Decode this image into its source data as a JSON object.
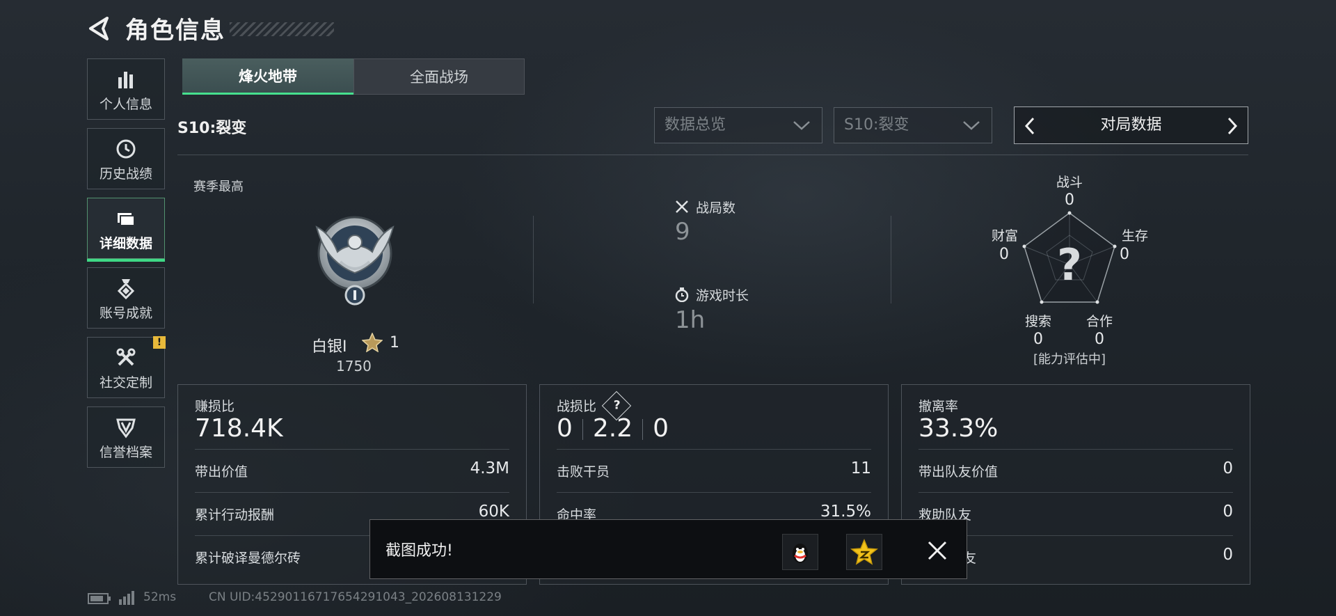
{
  "header": {
    "title": "角色信息"
  },
  "sidebar": {
    "items": [
      {
        "label": "个人信息",
        "icon": "bar-chart-icon"
      },
      {
        "label": "历史战绩",
        "icon": "clock-history-icon"
      },
      {
        "label": "详细数据",
        "icon": "folder-icon",
        "active": true
      },
      {
        "label": "账号成就",
        "icon": "medal-icon"
      },
      {
        "label": "社交定制",
        "icon": "tools-icon",
        "badge": "!"
      },
      {
        "label": "信誉档案",
        "icon": "shield-emblem-icon"
      }
    ]
  },
  "tabs": [
    {
      "label": "烽火地带",
      "active": true
    },
    {
      "label": "全面战场"
    }
  ],
  "season": {
    "label": "S10:裂变"
  },
  "filters": {
    "overview": "数据总览",
    "season": "S10:裂变",
    "pager": "对局数据"
  },
  "rank": {
    "heading": "赛季最高",
    "name": "白银I",
    "stars": "1",
    "score": "1750"
  },
  "stats": {
    "matches_label": "战局数",
    "matches_value": "9",
    "playtime_label": "游戏时长",
    "playtime_value": "1h"
  },
  "radar": {
    "combat": {
      "label": "战斗",
      "value": "0"
    },
    "survival": {
      "label": "生存",
      "value": "0"
    },
    "cooperation": {
      "label": "合作",
      "value": "0"
    },
    "search": {
      "label": "搜索",
      "value": "0"
    },
    "wealth": {
      "label": "财富",
      "value": "0"
    },
    "status": "[能力评估中]",
    "center": "?"
  },
  "cards": {
    "profit": {
      "title": "赚损比",
      "value": "718.4K",
      "rows": [
        {
          "label": "带出价值",
          "value": "4.3M"
        },
        {
          "label": "累计行动报酬",
          "value": "60K"
        },
        {
          "label": "累计破译曼德尔砖",
          "value": ""
        }
      ]
    },
    "combat": {
      "title": "战损比",
      "help": "?",
      "kd": [
        "0",
        "2.2",
        "0"
      ],
      "rows": [
        {
          "label": "击败干员",
          "value": "11"
        },
        {
          "label": "命中率",
          "value": "31.5%"
        }
      ]
    },
    "extract": {
      "title": "撤离率",
      "value": "33.3%",
      "rows": [
        {
          "label": "带出队友价值",
          "value": "0"
        },
        {
          "label": "救助队友",
          "value": "0"
        },
        {
          "label": "友",
          "value": "0"
        }
      ]
    }
  },
  "toast": {
    "text": "截图成功!"
  },
  "footer": {
    "ping": "52ms",
    "uid": "CN UID:452901167176542910​43_202608131229"
  },
  "colors": {
    "accent": "#3fd986",
    "warning": "#e8b93a"
  }
}
